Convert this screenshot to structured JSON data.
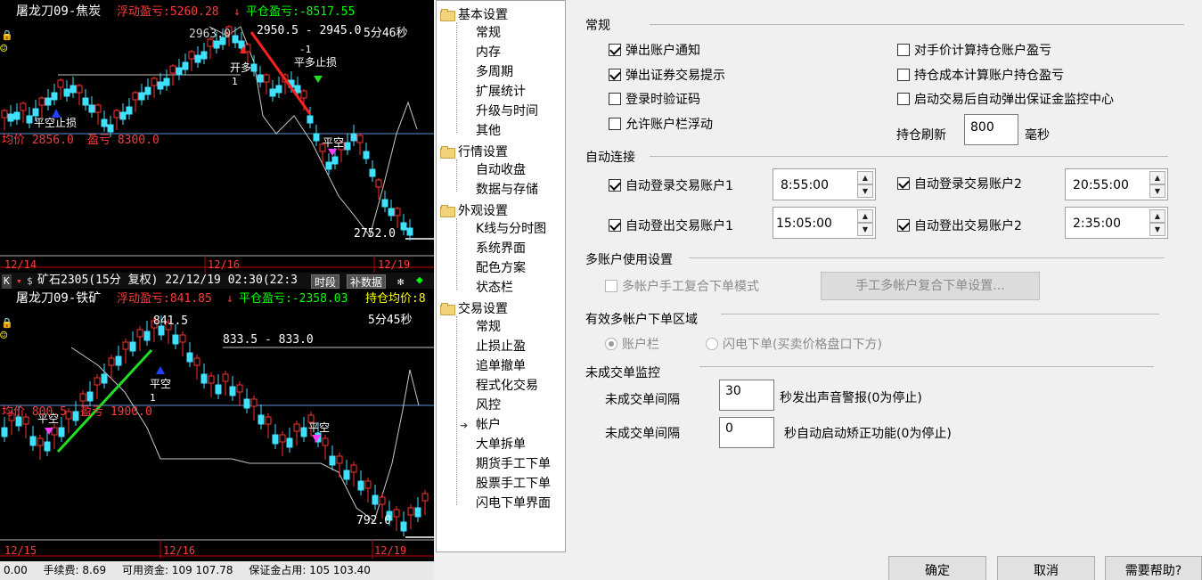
{
  "chart_top": {
    "title_prefix": "屠龙刀09-焦炭",
    "float_pl": "浮动盈亏:5260.28",
    "float_arrow": "↓",
    "close_pl": "平仓盈亏:-8517.55",
    "price_high": "2963.0",
    "range_label": "2950.5 - 2945.0",
    "countdown": "5分46秒",
    "label_open_long": "开多",
    "label_open_long_num": "1",
    "label_stop_long": "平多止损",
    "label_stop_long_num": "-1",
    "label_stop_short": "平空止损",
    "label_flat_short": "平空",
    "avg_price": "均价 2856.0",
    "avg_pl": "盈亏 8300.0",
    "price_low": "2752.0",
    "dates": [
      "12/14",
      "12/16",
      "12/19"
    ]
  },
  "chart_bottom": {
    "header_symbol": "矿石2305(15分 复权) 22/12/19 02:30(22:3",
    "btn_period": "时段",
    "btn_fill": "补数据",
    "title_prefix": "屠龙刀09-铁矿",
    "float_pl": "浮动盈亏:841.85",
    "float_arrow": "↓",
    "close_pl": "平仓盈亏:-2358.03",
    "hold_avg": "持仓均价:8",
    "price_high": "841.5",
    "range_label": "833.5 - 833.0",
    "countdown": "5分45秒",
    "label_flat_short_1": "平空",
    "label_flat_short_num": "1",
    "label_flat_short_2": "平空",
    "label_flat_short_3": "平空",
    "avg_price": "均价 800.5",
    "avg_pl": "盈亏 1900.0",
    "price_low": "792.0",
    "dates": [
      "12/15",
      "12/16",
      "12/19"
    ]
  },
  "statusbar": {
    "value0": "0.00",
    "fee": "手续费: 8.69",
    "available": "可用资金: 109 107.78",
    "margin": "保证金占用: 105 103.40"
  },
  "tree": {
    "groups": [
      {
        "label": "基本设置",
        "items": [
          "常规",
          "内存",
          "多周期",
          "扩展统计",
          "升级与时间",
          "其他"
        ]
      },
      {
        "label": "行情设置",
        "items": [
          "自动收盘",
          "数据与存储"
        ]
      },
      {
        "label": "外观设置",
        "items": [
          "K线与分时图",
          "系统界面",
          "配色方案",
          "状态栏"
        ]
      },
      {
        "label": "交易设置",
        "items": [
          "常规",
          "止损止盈",
          "追单撤单",
          "程式化交易",
          "风控",
          "帐户",
          "大单拆单",
          "期货手工下单",
          "股票手工下单",
          "闪电下单界面"
        ]
      }
    ],
    "selected": "帐户"
  },
  "settings": {
    "general": {
      "title": "常规",
      "checks": [
        {
          "label": "弹出账户通知",
          "checked": true
        },
        {
          "label": "弹出证券交易提示",
          "checked": true
        },
        {
          "label": "登录时验证码",
          "checked": false
        },
        {
          "label": "允许账户栏浮动",
          "checked": false
        },
        {
          "label": "对手价计算持仓账户盈亏",
          "checked": false
        },
        {
          "label": "持仓成本计算账户持仓盈亏",
          "checked": false
        },
        {
          "label": "启动交易后自动弹出保证金监控中心",
          "checked": false
        }
      ],
      "refresh_label": "持仓刷新",
      "refresh_value": "800",
      "refresh_unit": "毫秒"
    },
    "auto_connect": {
      "title": "自动连接",
      "rows": [
        {
          "label": "自动登录交易账户1",
          "checked": true,
          "time": "8:55:00"
        },
        {
          "label": "自动登录交易账户2",
          "checked": true,
          "time": "20:55:00"
        },
        {
          "label": "自动登出交易账户1",
          "checked": true,
          "time": "15:05:00"
        },
        {
          "label": "自动登出交易账户2",
          "checked": true,
          "time": "2:35:00"
        }
      ]
    },
    "multi_account": {
      "title": "多账户使用设置",
      "check_label": "多帐户手工复合下单模式",
      "button_label": "手工多帐户复合下单设置..."
    },
    "order_area": {
      "title": "有效多帐户下单区域",
      "options": [
        "账户栏",
        "闪电下单(买卖价格盘口下方)"
      ],
      "selected": 0
    },
    "pending_monitor": {
      "title": "未成交单监控",
      "row1_label": "未成交单间隔",
      "row1_value": "30",
      "row1_suffix": "秒发出声音警报(0为停止)",
      "row2_label": "未成交单间隔",
      "row2_value": "0",
      "row2_suffix": "秒自动启动矫正功能(0为停止)"
    }
  },
  "buttons": {
    "ok": "确定",
    "cancel": "取消",
    "help": "需要帮助?"
  }
}
